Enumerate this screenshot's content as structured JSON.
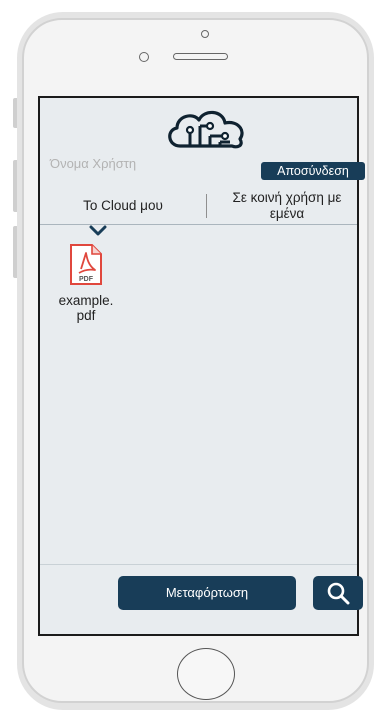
{
  "header": {
    "username_label": "Όνομα Χρήστη",
    "logout_label": "Αποσύνδεση"
  },
  "tabs": [
    {
      "label": "Το Cloud μου",
      "active": true
    },
    {
      "label": "Σε κοινή χρήση με εμένα",
      "active": false
    }
  ],
  "files": [
    {
      "name": "example. pdf",
      "type": "PDF"
    }
  ],
  "footer": {
    "upload_label": "Μεταφόρτωση"
  },
  "icons": {
    "logo": "cloud-circuit-icon",
    "file": "pdf-file-icon",
    "search": "search-icon",
    "indicator": "chevron-down-icon"
  },
  "colors": {
    "accent": "#183d58",
    "screen_bg": "#e8ecef",
    "muted_text": "#b3b3b3",
    "pdf_red": "#e0473d"
  }
}
